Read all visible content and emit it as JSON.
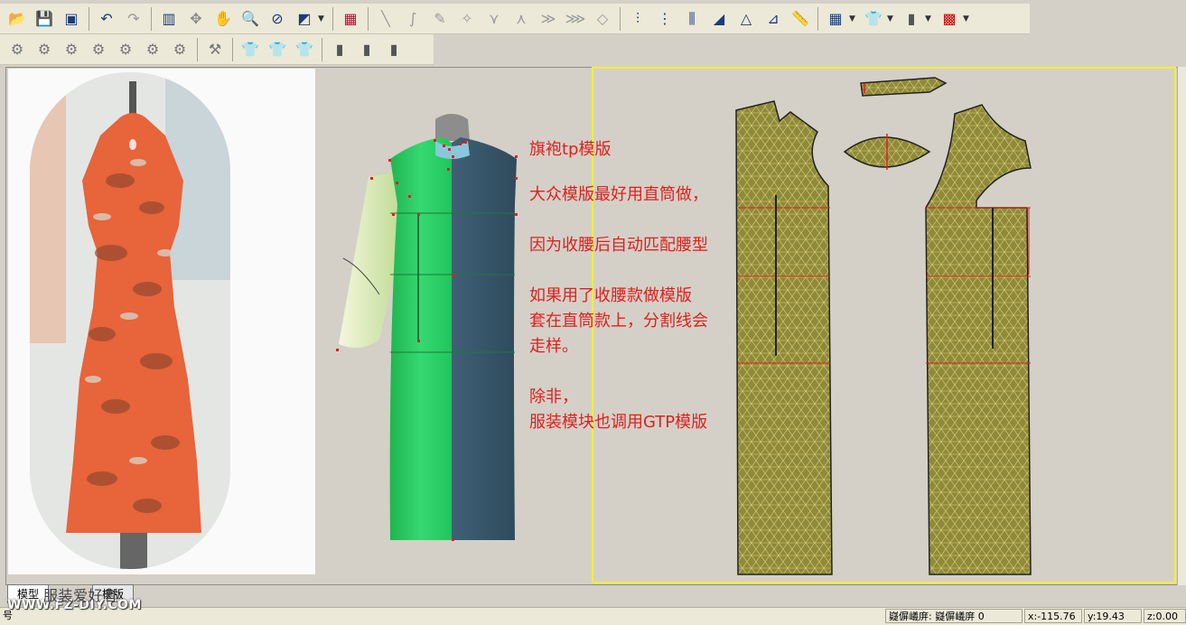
{
  "toolbar1": {
    "icons": [
      "open-folder",
      "save",
      "save-as",
      "undo",
      "redo",
      "frame",
      "rotate",
      "hand-pan",
      "zoom-search",
      "3d-view",
      "render",
      "dropdown",
      "map",
      "line",
      "curve",
      "pencil",
      "point",
      "dart",
      "tuck",
      "pleat",
      "fold",
      "eraser",
      "measure-a",
      "measure-b",
      "measure-c",
      "measure-d",
      "triangle-a",
      "triangle-b",
      "ruler",
      "grid-view",
      "shirt",
      "trousers",
      "color-grid"
    ]
  },
  "toolbar2": {
    "icons": [
      "shape-a",
      "shape-b",
      "shape-c",
      "shape-d",
      "shape-e",
      "shape-f",
      "shape-g",
      "sleeve-shirt",
      "short-shirt",
      "plain-shirt",
      "pants-a",
      "pants-b",
      "pants-c"
    ]
  },
  "notes": {
    "line1": "旗袍tp模版",
    "line2": "大众模版最好用直筒做，",
    "line3": "因为收腰后自动匹配腰型",
    "line4": "如果用了收腰款做模版",
    "line5": "套在直筒款上，分割线会",
    "line6": "走样。",
    "line7": "除非，",
    "line8": "服装模块也调用GTP模版"
  },
  "tabs": {
    "tab1": "模型",
    "tab2": "模版"
  },
  "watermark": {
    "line1": "服装爱好者",
    "line2": "WWW.FZ-DIY.COM"
  },
  "status": {
    "left": "号",
    "mode": "嶷偋嶬庰: 嶷偋嶬庰 0",
    "x": "x:-115.76",
    "y": "y:19.43",
    "z": "z:0.00"
  },
  "colors": {
    "note_text": "#e0201c",
    "body_green": "#2fd46a",
    "body_slate": "#3f5f73",
    "pattern_olive": "#8f8a3a",
    "selection_border": "#f2ef38"
  }
}
